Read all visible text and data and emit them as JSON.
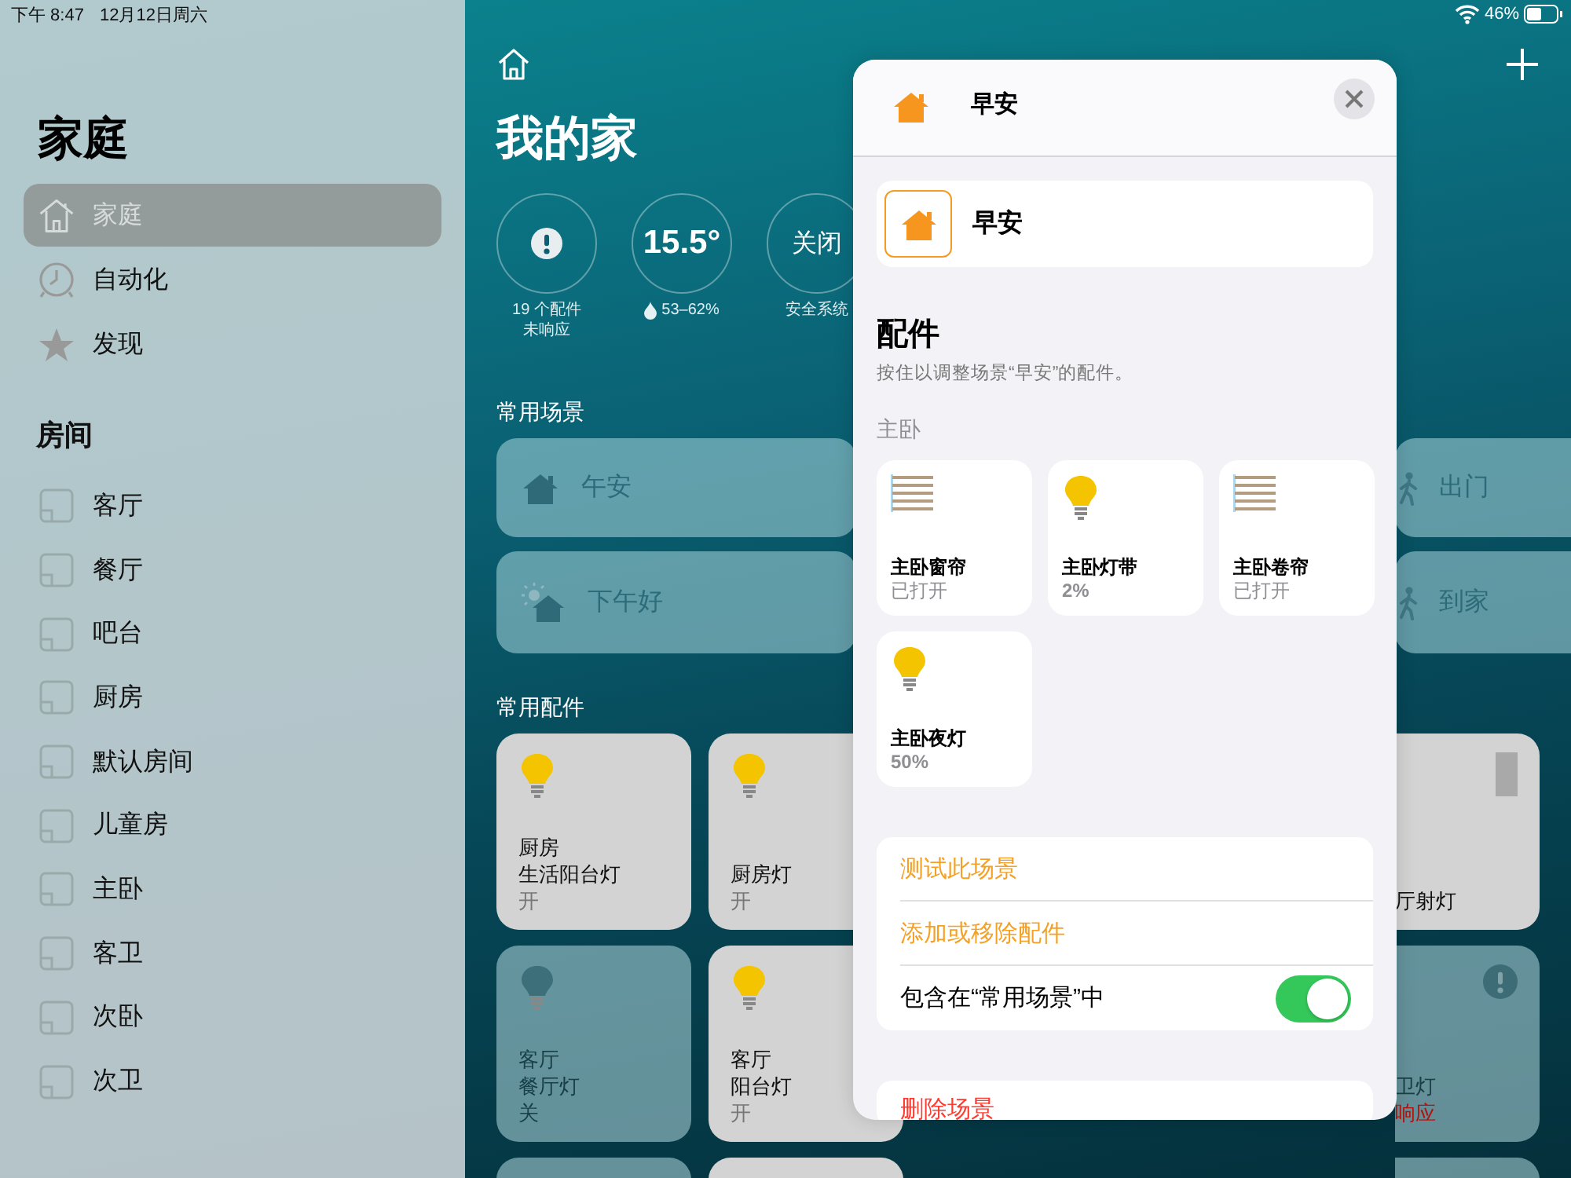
{
  "status_bar": {
    "time": "下午 8:47",
    "date": "12月12日周六",
    "battery": "46%"
  },
  "sidebar": {
    "title": "家庭",
    "items": [
      {
        "label": "家庭",
        "kind": "home",
        "selected": true
      },
      {
        "label": "自动化",
        "kind": "automation",
        "selected": false
      },
      {
        "label": "发现",
        "kind": "discover",
        "selected": false
      }
    ],
    "rooms_heading": "房间",
    "rooms": [
      {
        "label": "客厅",
        "selected": false
      },
      {
        "label": "餐厅",
        "selected": false
      },
      {
        "label": "吧台",
        "selected": false
      },
      {
        "label": "厨房",
        "selected": false
      },
      {
        "label": "默认房间",
        "selected": false
      },
      {
        "label": "儿童房",
        "selected": false
      },
      {
        "label": "主卧",
        "selected": false
      },
      {
        "label": "客卫",
        "selected": false
      },
      {
        "label": "次卧",
        "selected": false
      },
      {
        "label": "次卫",
        "selected": false
      }
    ]
  },
  "home": {
    "title": "我的家",
    "status": [
      {
        "kind": "alert",
        "lines": [
          "19 个配件",
          "未响应"
        ]
      },
      {
        "kind": "climate",
        "value": "15.5°",
        "lines": [
          "53–62%"
        ]
      },
      {
        "kind": "text",
        "value": "关闭",
        "lines": [
          "安全系统"
        ]
      }
    ],
    "scenes_heading": "常用场景",
    "scenes": [
      {
        "name": "午安",
        "kind": "home"
      },
      {
        "name": "下午好",
        "kind": "sun-home"
      }
    ],
    "scenes_right": [
      {
        "name": "出门",
        "kind": "walk"
      },
      {
        "name": "到家",
        "kind": "walk"
      }
    ],
    "accessories_heading": "常用配件",
    "accessories": [
      {
        "lines": [
          "厨房",
          "生活阳台灯"
        ],
        "status": "开",
        "kind": "bulb",
        "on": true
      },
      {
        "lines": [
          "厨房灯"
        ],
        "status": "开",
        "kind": "bulb",
        "on": true
      },
      {
        "lines": [
          "客厅",
          "餐厅灯"
        ],
        "status": "关",
        "kind": "bulb",
        "on": false
      },
      {
        "lines": [
          "客厅",
          "阳台灯"
        ],
        "status": "开",
        "kind": "bulb",
        "on": true
      },
      {
        "kind": "blank",
        "on": false
      },
      {
        "kind": "blank",
        "on": true
      }
    ],
    "accessories_right": [
      {
        "lines": [
          "厅射灯"
        ],
        "kind": "spot",
        "on": true
      },
      {
        "lines": [
          "卫灯"
        ],
        "status": "响应",
        "kind": "alert",
        "on": false
      },
      {
        "kind": "blank",
        "on": false
      }
    ]
  },
  "modal": {
    "title": "早安",
    "scene_name": "早安",
    "section_title": "配件",
    "section_hint": "按住以调整场景“早安”的配件。",
    "room": "主卧",
    "accessories": [
      {
        "name": "主卧窗帘",
        "status": "已打开",
        "kind": "blinds"
      },
      {
        "name": "主卧灯带",
        "status": "2%",
        "kind": "bulb"
      },
      {
        "name": "主卧卷帘",
        "status": "已打开",
        "kind": "blinds"
      },
      {
        "name": "主卧夜灯",
        "status": "50%",
        "kind": "bulb"
      }
    ],
    "actions": [
      {
        "label": "测试此场景",
        "kind": "action"
      },
      {
        "label": "添加或移除配件",
        "kind": "action"
      },
      {
        "label": "包含在“常用场景”中",
        "kind": "toggle",
        "on": true
      }
    ],
    "delete": "删除场景"
  }
}
